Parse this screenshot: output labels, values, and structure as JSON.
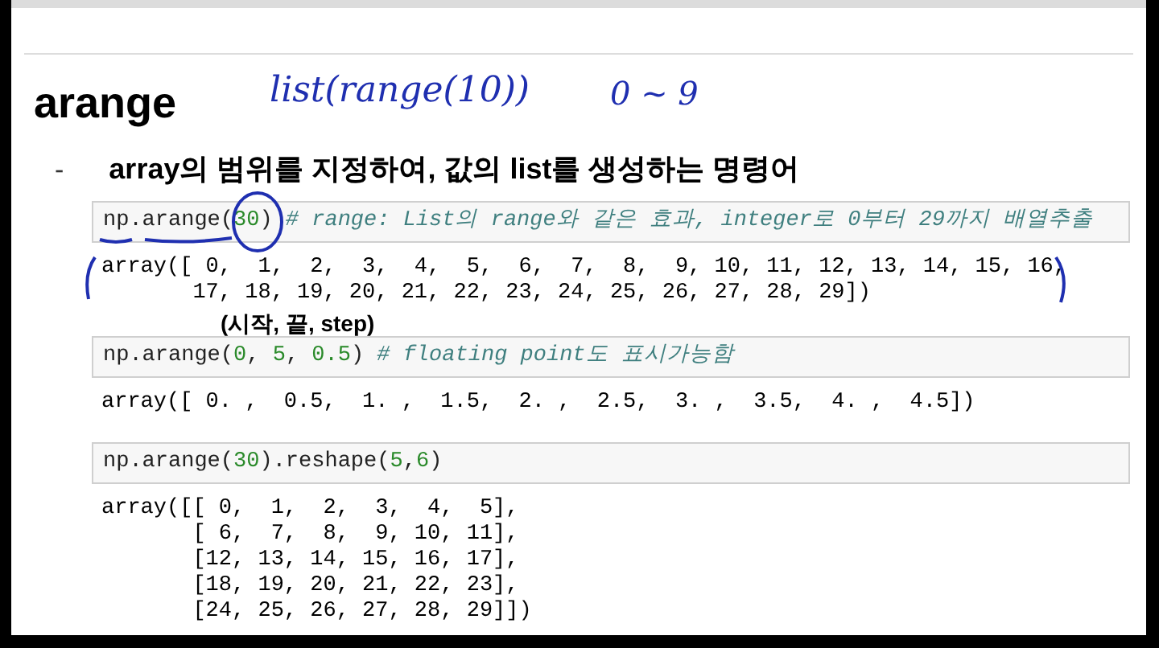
{
  "title": "arange",
  "handwriting": [
    {
      "text": "list(range(10))"
    },
    {
      "text": "0 ~ 9"
    }
  ],
  "bullet": {
    "marker": "-",
    "text": "array의 범위를 지정하여, 값의 list를 생성하는 명령어"
  },
  "cells": [
    {
      "input": [
        {
          "text": "np.arange(",
          "kind": "plain"
        },
        {
          "text": "30",
          "kind": "number"
        },
        {
          "text": ") ",
          "kind": "plain"
        },
        {
          "text": "# range: List의 range와 같은 효과, integer로 0부터 29까지 배열추출",
          "kind": "comment"
        }
      ],
      "output": [
        "array([ 0,  1,  2,  3,  4,  5,  6,  7,  8,  9, 10, 11, 12, 13, 14, 15, 16,",
        "       17, 18, 19, 20, 21, 22, 23, 24, 25, 26, 27, 28, 29])"
      ],
      "note": "(시작, 끝, step)"
    },
    {
      "input": [
        {
          "text": "np.arange(",
          "kind": "plain"
        },
        {
          "text": "0",
          "kind": "number"
        },
        {
          "text": ", ",
          "kind": "plain"
        },
        {
          "text": "5",
          "kind": "number"
        },
        {
          "text": ", ",
          "kind": "plain"
        },
        {
          "text": "0.5",
          "kind": "number"
        },
        {
          "text": ") ",
          "kind": "plain"
        },
        {
          "text": "# floating point도 표시가능함",
          "kind": "comment"
        }
      ],
      "output": [
        "array([ 0. ,  0.5,  1. ,  1.5,  2. ,  2.5,  3. ,  3.5,  4. ,  4.5])"
      ]
    },
    {
      "input": [
        {
          "text": "np.arange(",
          "kind": "plain"
        },
        {
          "text": "30",
          "kind": "number"
        },
        {
          "text": ").reshape(",
          "kind": "plain"
        },
        {
          "text": "5",
          "kind": "number"
        },
        {
          "text": ",",
          "kind": "plain"
        },
        {
          "text": "6",
          "kind": "number"
        },
        {
          "text": ")",
          "kind": "plain"
        }
      ],
      "output": [
        "array([[ 0,  1,  2,  3,  4,  5],",
        "       [ 6,  7,  8,  9, 10, 11],",
        "       [12, 13, 14, 15, 16, 17],",
        "       [18, 19, 20, 21, 22, 23],",
        "       [24, 25, 26, 27, 28, 29]])"
      ]
    }
  ]
}
